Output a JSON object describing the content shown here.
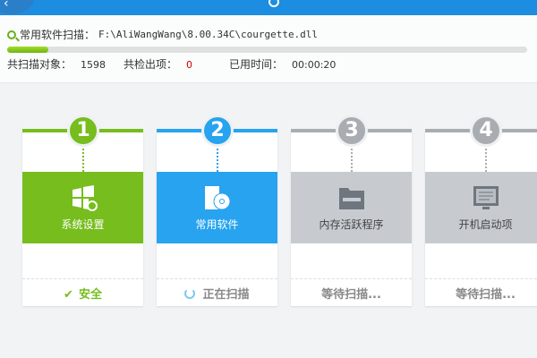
{
  "scan": {
    "label": "常用软件扫描：",
    "path": "F:\\AliWangWang\\8.00.34C\\courgette.dll",
    "progress_percent": 8
  },
  "stats": {
    "objects_label": "共扫描对象：",
    "objects": "1598",
    "found_label": "共检出项：",
    "found": "0",
    "time_label": "已用时间：",
    "time": "00:00:20"
  },
  "steps": [
    {
      "num": "1",
      "label": "系统设置",
      "status": "安全",
      "color": "#76bd1d"
    },
    {
      "num": "2",
      "label": "常用软件",
      "status": "正在扫描",
      "color": "#27a3ef"
    },
    {
      "num": "3",
      "label": "内存活跃程序",
      "status": "等待扫描...",
      "color": "#a9adb2"
    },
    {
      "num": "4",
      "label": "开机启动项",
      "status": "等待扫描...",
      "color": "#a9adb2"
    }
  ]
}
